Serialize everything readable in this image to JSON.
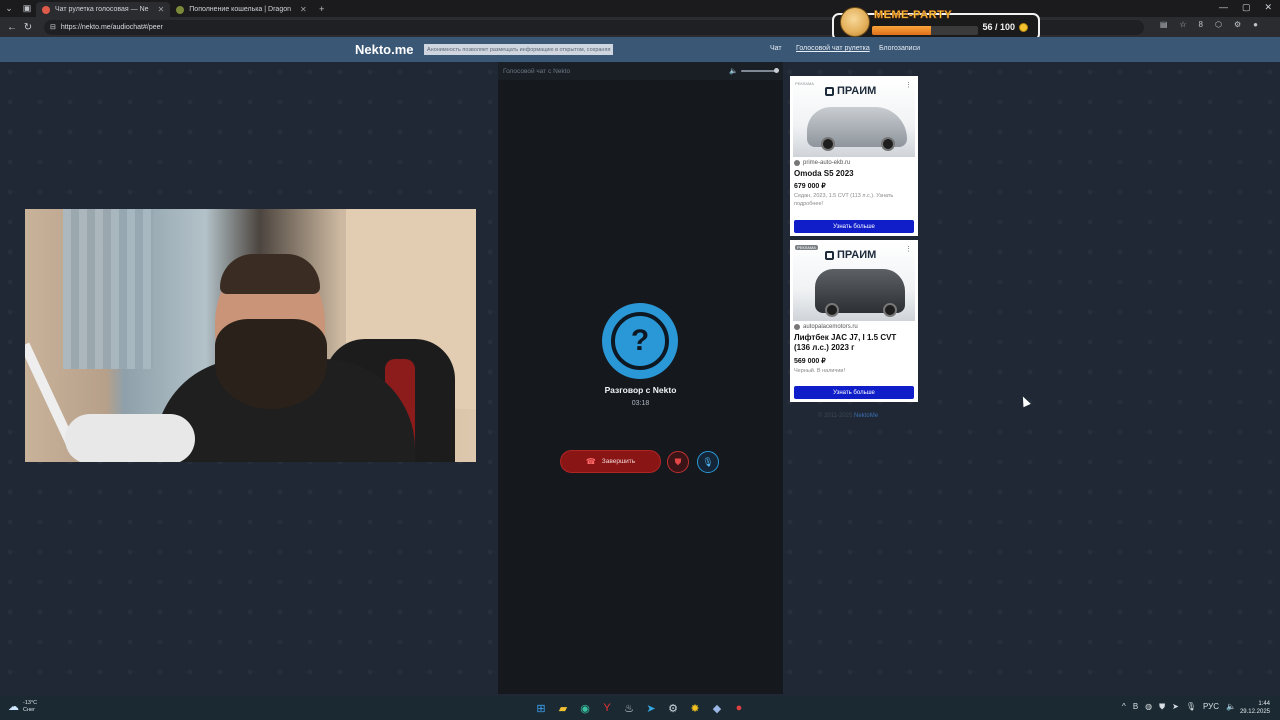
{
  "browser": {
    "tabs": [
      {
        "title": "Чат рулетка голосовая — Ne",
        "active": true,
        "favicon_color": "#e05a4a"
      },
      {
        "title": "Пополнение кошелька | Dragon",
        "active": false,
        "favicon_color": "#7a8a3a"
      }
    ],
    "new_tab_label": "+",
    "url": "https://nekto.me/audiochat#/peer",
    "address_right_count": "8"
  },
  "meme_party": {
    "title": "MEME-PARTY",
    "score": "56 / 100",
    "progress_fraction": 0.56
  },
  "site": {
    "logo": "Nekto.me",
    "anon_note": "Анонимность позволяет размещать информацию в открытом, сохраняя",
    "nav": [
      {
        "label": "Чат",
        "active": false
      },
      {
        "label": "Голосовой чат рулетка",
        "active": true
      },
      {
        "label": "Блогозаписи",
        "active": false
      }
    ]
  },
  "chat": {
    "header": "Голосовой чат с Nekto",
    "peer_symbol": "?",
    "peer_name": "Разговор с Nekto",
    "timer": "03:18",
    "end_label": "Завершить",
    "volume_fraction": 1.0
  },
  "ads": [
    {
      "badge": "РЕКЛАМА",
      "brand": "ПРАИМ",
      "domain": "prime-auto-ekb.ru",
      "title": "Omoda S5 2023",
      "price": "679 000 ₽",
      "desc": "Седан, 2023, 1.5 CVT (113 л.с.). Узнать подробнее!",
      "cta": "Узнать больше"
    },
    {
      "badge": "РЕКЛАМА",
      "brand": "ПРАИМ",
      "domain": "autopalacemotors.ru",
      "title": "Лифтбек JAC J7, I 1.5 CVT (136 л.с.) 2023 г",
      "price": "569 000 ₽",
      "desc": "Черный. В наличии!",
      "cta": "Узнать больше"
    }
  ],
  "footer": {
    "copyright": "© 2011-2025",
    "link": "NektoMe"
  },
  "taskbar": {
    "temperature": "-13°C",
    "weather": "Снег",
    "lang": "РУС",
    "time": "1:44",
    "date": "29.12.2025"
  }
}
